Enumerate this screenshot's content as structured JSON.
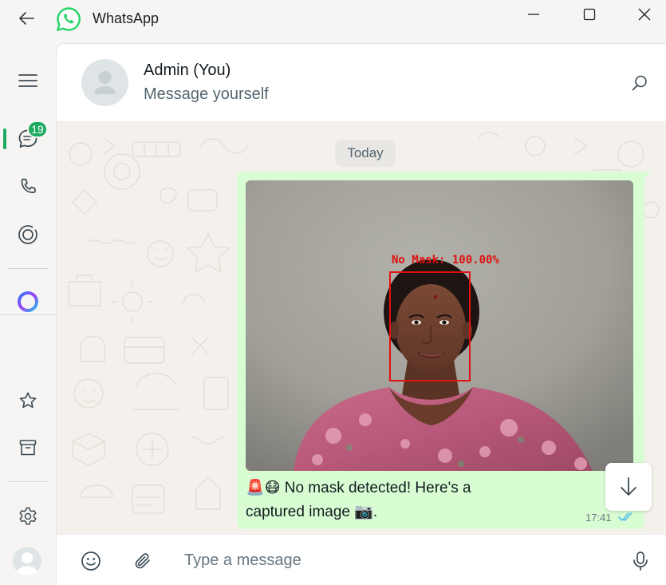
{
  "app": {
    "title": "WhatsApp"
  },
  "rail": {
    "unread_count": "19"
  },
  "chat": {
    "contact_name": "Admin (You)",
    "contact_subtitle": "Message yourself",
    "date_chip": "Today",
    "message": {
      "image_label": "No Mask: 100.00%",
      "caption_line1": "🚨😷 No mask detected! Here's a",
      "caption_line2": "captured image 📷.",
      "time": "17:41"
    }
  },
  "composer": {
    "placeholder": "Type a message"
  },
  "colors": {
    "accent": "#1daa61",
    "bubble": "#d9fdd3",
    "detection_box": "#e01010",
    "read_ticks": "#53bdeb"
  },
  "icons": [
    "back-arrow-icon",
    "whatsapp-logo-icon",
    "minimize-icon",
    "maximize-icon",
    "close-icon",
    "menu-icon",
    "chats-icon",
    "calls-icon",
    "status-icon",
    "meta-ai-icon",
    "starred-icon",
    "archive-icon",
    "settings-icon",
    "profile-avatar-icon",
    "search-icon",
    "scroll-down-icon",
    "emoji-icon",
    "attach-icon",
    "microphone-icon",
    "read-ticks-icon"
  ]
}
